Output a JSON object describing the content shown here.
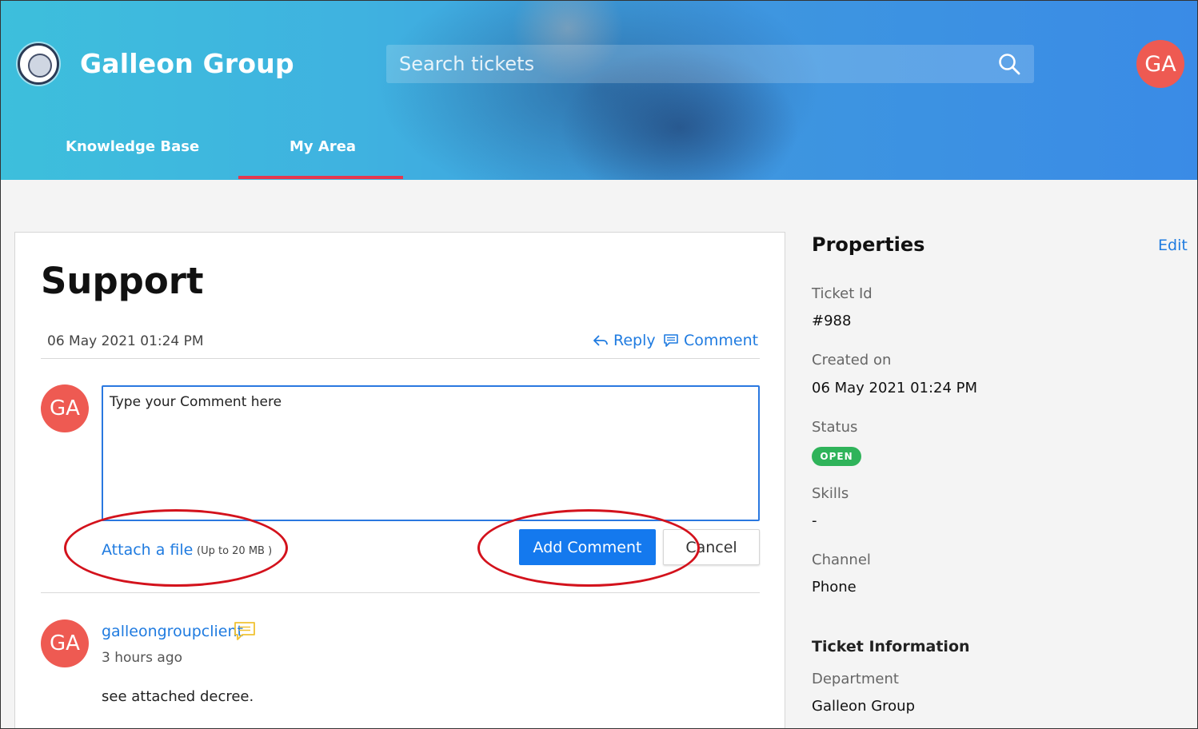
{
  "header": {
    "brand": "Galleon Group",
    "search_placeholder": "Search tickets",
    "user_initials": "GA",
    "tabs": [
      {
        "label": "Knowledge Base"
      },
      {
        "label": "My Area"
      }
    ],
    "active_tab": "My Area"
  },
  "ticket": {
    "title": "Support",
    "date": "06 May 2021 01:24 PM",
    "reply_label": "Reply",
    "comment_label": "Comment"
  },
  "comment_form": {
    "user_initials": "GA",
    "text": "Type your Comment here",
    "attach_label": "Attach a file",
    "attach_note": "(Up to 20 MB )",
    "add_button": "Add Comment",
    "cancel_button": "Cancel"
  },
  "thread": [
    {
      "initials": "GA",
      "user": "galleongroupclient",
      "time": "3 hours ago",
      "message": "see attached decree."
    }
  ],
  "properties": {
    "title": "Properties",
    "edit_label": "Edit",
    "fields": [
      {
        "label": "Ticket Id",
        "value": "#988"
      },
      {
        "label": "Created on",
        "value": "06 May 2021 01:24 PM"
      },
      {
        "label": "Status",
        "value": "OPEN"
      },
      {
        "label": "Skills",
        "value": "-"
      },
      {
        "label": "Channel",
        "value": "Phone"
      }
    ],
    "ticket_info_title": "Ticket Information",
    "department_label": "Department",
    "department_value": "Galleon Group"
  },
  "colors": {
    "accent": "#1479ee",
    "tab_underline": "#e5384f",
    "avatar": "#ee5a52",
    "status_open": "#2fb35a",
    "annotation": "#d3121c"
  }
}
